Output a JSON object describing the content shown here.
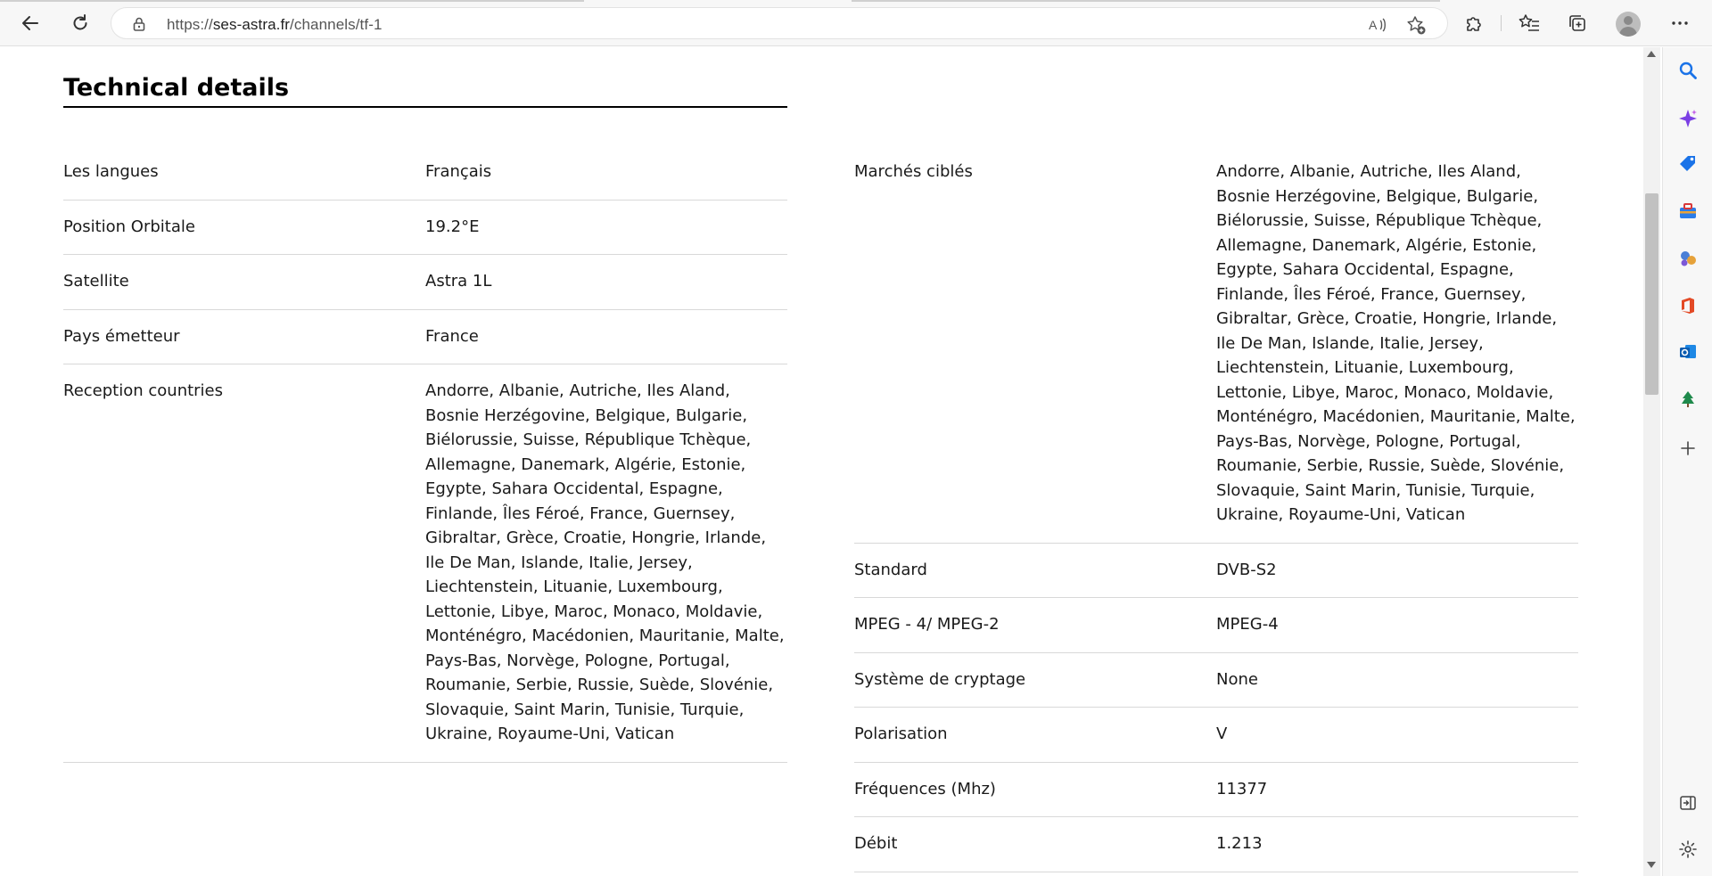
{
  "browser": {
    "url_prefix": "https://",
    "url_host": "ses-astra.fr",
    "url_path": "/channels/tf-1",
    "icons": {
      "back": "arrow-left-icon",
      "refresh": "refresh-icon",
      "lock": "lock-icon",
      "read_aloud": "read-aloud-icon",
      "add_favorite": "star-add-icon",
      "extensions": "puzzle-icon",
      "favorites": "favorites-list-icon",
      "collections": "collections-icon",
      "profile": "avatar",
      "more": "more-dots-icon"
    }
  },
  "page": {
    "section_title": "Technical details",
    "left_rows": [
      {
        "label": "Les langues",
        "value": "Français"
      },
      {
        "label": "Position Orbitale",
        "value": "19.2°E"
      },
      {
        "label": "Satellite",
        "value": "Astra 1L"
      },
      {
        "label": "Pays émetteur",
        "value": "France"
      },
      {
        "label": "Reception countries",
        "value": "Andorre, Albanie, Autriche, Iles Aland, Bosnie Herzégovine, Belgique, Bulgarie, Biélorussie, Suisse, République Tchèque, Allemagne, Danemark, Algérie, Estonie, Egypte, Sahara Occidental, Espagne, Finlande, Îles Féroé, France, Guernsey, Gibraltar, Grèce, Croatie, Hongrie, Irlande, Ile De Man, Islande, Italie, Jersey, Liechtenstein, Lituanie, Luxembourg, Lettonie, Libye, Maroc, Monaco, Moldavie, Monténégro, Macédonien, Mauritanie, Malte, Pays-Bas, Norvège, Pologne, Portugal, Roumanie, Serbie, Russie, Suède, Slovénie, Slovaquie, Saint Marin, Tunisie, Turquie, Ukraine, Royaume-Uni, Vatican"
      }
    ],
    "right_rows": [
      {
        "label": "Marchés ciblés",
        "value": "Andorre, Albanie, Autriche, Iles Aland, Bosnie Herzégovine, Belgique, Bulgarie, Biélorussie, Suisse, République Tchèque, Allemagne, Danemark, Algérie, Estonie, Egypte, Sahara Occidental, Espagne, Finlande, Îles Féroé, France, Guernsey, Gibraltar, Grèce, Croatie, Hongrie, Irlande, Ile De Man, Islande, Italie, Jersey, Liechtenstein, Lituanie, Luxembourg, Lettonie, Libye, Maroc, Monaco, Moldavie, Monténégro, Macédonien, Mauritanie, Malte, Pays-Bas, Norvège, Pologne, Portugal, Roumanie, Serbie, Russie, Suède, Slovénie, Slovaquie, Saint Marin, Tunisie, Turquie, Ukraine, Royaume-Uni, Vatican"
      },
      {
        "label": "Standard",
        "value": "DVB-S2"
      },
      {
        "label": "MPEG - 4/ MPEG-2",
        "value": "MPEG-4"
      },
      {
        "label": "Système de cryptage",
        "value": "None"
      },
      {
        "label": "Polarisation",
        "value": "V"
      },
      {
        "label": "Fréquences (Mhz)",
        "value": "11377"
      },
      {
        "label": "Débit",
        "value": "1.213"
      }
    ]
  },
  "sidebar": {
    "icons": [
      "search-icon",
      "copilot-icon",
      "shopping-tag-icon",
      "tools-icon",
      "games-icon",
      "office-icon",
      "outlook-icon",
      "tree-icon",
      "add-icon"
    ],
    "bottom_icons": [
      "sidebar-toggle-icon",
      "settings-gear-icon"
    ]
  },
  "colors": {
    "accent_blue": "#1a73e8",
    "text": "#1a1a1a",
    "rule": "#d8d8d8"
  }
}
